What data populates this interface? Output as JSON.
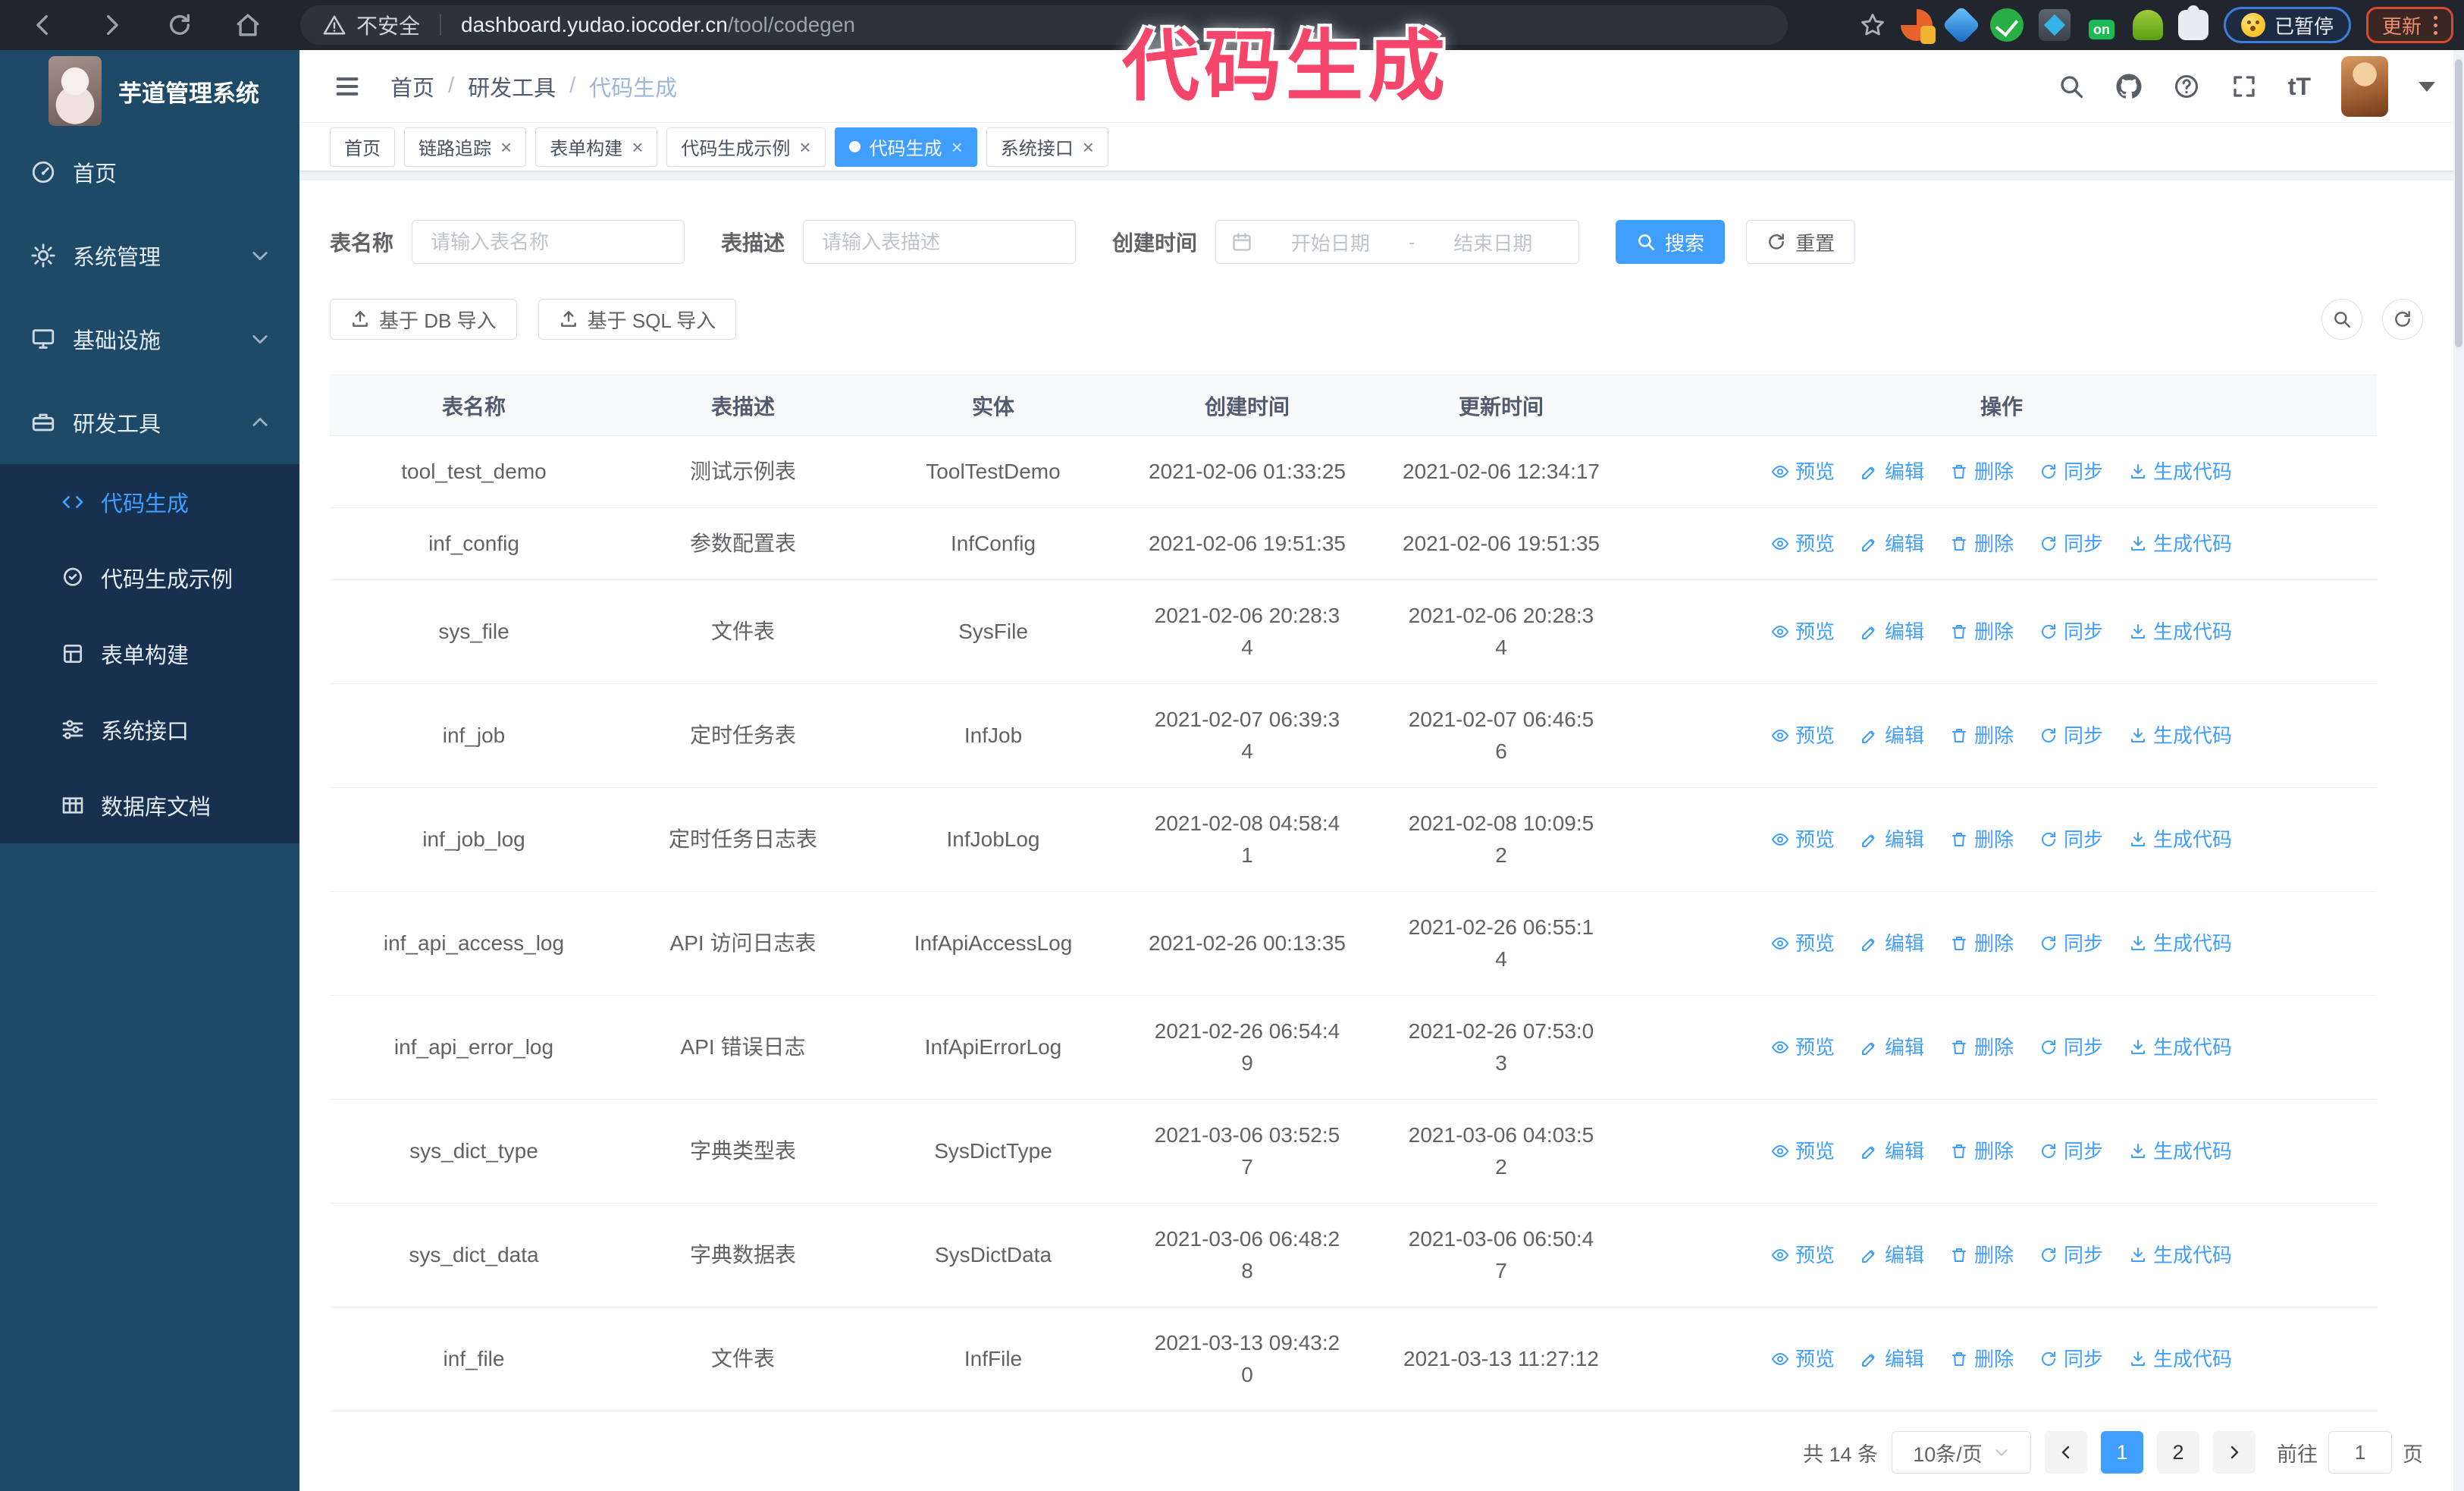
{
  "browser": {
    "security_label": "不安全",
    "url_host": "dashboard.yudao.iocoder.cn",
    "url_path": "/tool/codegen",
    "paused_badge": "已暂停",
    "update_button": "更新"
  },
  "annotation": {
    "text": "代码生成",
    "color": "#f5456b"
  },
  "app": {
    "title": "芋道管理系统"
  },
  "breadcrumb": {
    "separator": "/",
    "items": [
      "首页",
      "研发工具",
      "代码生成"
    ]
  },
  "sidebar": {
    "items": [
      {
        "label": "首页",
        "icon": "dashboard-icon"
      },
      {
        "label": "系统管理",
        "icon": "gear-icon",
        "state": "collapsed"
      },
      {
        "label": "基础设施",
        "icon": "monitor-icon",
        "state": "collapsed"
      },
      {
        "label": "研发工具",
        "icon": "toolbox-icon",
        "state": "expanded",
        "children": [
          {
            "label": "代码生成",
            "icon": "code-icon",
            "active": true
          },
          {
            "label": "代码生成示例",
            "icon": "badge-check-icon",
            "active": false
          },
          {
            "label": "表单构建",
            "icon": "form-icon",
            "active": false
          },
          {
            "label": "系统接口",
            "icon": "sliders-icon",
            "active": false
          },
          {
            "label": "数据库文档",
            "icon": "table-grid-icon",
            "active": false
          }
        ]
      }
    ]
  },
  "tags": {
    "items": [
      {
        "label": "首页",
        "closable": false,
        "active": false
      },
      {
        "label": "链路追踪",
        "closable": true,
        "active": false
      },
      {
        "label": "表单构建",
        "closable": true,
        "active": false
      },
      {
        "label": "代码生成示例",
        "closable": true,
        "active": false
      },
      {
        "label": "代码生成",
        "closable": true,
        "active": true
      },
      {
        "label": "系统接口",
        "closable": true,
        "active": false
      }
    ]
  },
  "search": {
    "name_label": "表名称",
    "name_placeholder": "请输入表名称",
    "desc_label": "表描述",
    "desc_placeholder": "请输入表描述",
    "time_label": "创建时间",
    "start_placeholder": "开始日期",
    "range_separator": "-",
    "end_placeholder": "结束日期",
    "search_label": "搜索",
    "reset_label": "重置"
  },
  "toolbar": {
    "db_import_label": "基于 DB 导入",
    "sql_import_label": "基于 SQL 导入"
  },
  "table": {
    "columns": [
      "表名称",
      "表描述",
      "实体",
      "创建时间",
      "更新时间",
      "操作"
    ],
    "row_actions": [
      {
        "label": "预览",
        "icon": "eye-icon"
      },
      {
        "label": "编辑",
        "icon": "edit-icon"
      },
      {
        "label": "删除",
        "icon": "trash-icon"
      },
      {
        "label": "同步",
        "icon": "sync-icon"
      },
      {
        "label": "生成代码",
        "icon": "download-icon"
      }
    ],
    "rows": [
      {
        "name": "tool_test_demo",
        "desc": "测试示例表",
        "entity": "ToolTestDemo",
        "created": "2021-02-06 01:33:25",
        "updated": "2021-02-06 12:34:17"
      },
      {
        "name": "inf_config",
        "desc": "参数配置表",
        "entity": "InfConfig",
        "created": "2021-02-06 19:51:35",
        "updated": "2021-02-06 19:51:35"
      },
      {
        "name": "sys_file",
        "desc": "文件表",
        "entity": "SysFile",
        "created": "2021-02-06 20:28:3\n4",
        "updated": "2021-02-06 20:28:3\n4"
      },
      {
        "name": "inf_job",
        "desc": "定时任务表",
        "entity": "InfJob",
        "created": "2021-02-07 06:39:3\n4",
        "updated": "2021-02-07 06:46:5\n6"
      },
      {
        "name": "inf_job_log",
        "desc": "定时任务日志表",
        "entity": "InfJobLog",
        "created": "2021-02-08 04:58:4\n1",
        "updated": "2021-02-08 10:09:5\n2"
      },
      {
        "name": "inf_api_access_log",
        "desc": "API 访问日志表",
        "entity": "InfApiAccessLog",
        "created": "2021-02-26 00:13:35",
        "updated": "2021-02-26 06:55:1\n4"
      },
      {
        "name": "inf_api_error_log",
        "desc": "API 错误日志",
        "entity": "InfApiErrorLog",
        "created": "2021-02-26 06:54:4\n9",
        "updated": "2021-02-26 07:53:0\n3"
      },
      {
        "name": "sys_dict_type",
        "desc": "字典类型表",
        "entity": "SysDictType",
        "created": "2021-03-06 03:52:5\n7",
        "updated": "2021-03-06 04:03:5\n2"
      },
      {
        "name": "sys_dict_data",
        "desc": "字典数据表",
        "entity": "SysDictData",
        "created": "2021-03-06 06:48:2\n8",
        "updated": "2021-03-06 06:50:4\n7"
      },
      {
        "name": "inf_file",
        "desc": "文件表",
        "entity": "InfFile",
        "created": "2021-03-13 09:43:2\n0",
        "updated": "2021-03-13 11:27:12"
      }
    ]
  },
  "pagination": {
    "total": "共 14 条",
    "page_size": "10条/页",
    "pages": [
      "1",
      "2"
    ],
    "active_page": "1",
    "goto_label": "前往",
    "goto_value": "1",
    "page_unit": "页"
  },
  "colors": {
    "accent": "#409eff",
    "sidebar_bg": "#1e4a68",
    "submenu_bg": "#16304d",
    "chrome_bg": "#21262e",
    "annotation": "#f5456b"
  },
  "icons": [
    "back-icon",
    "forward-icon",
    "reload-icon",
    "home-icon",
    "warning-icon",
    "star-icon",
    "search-icon",
    "github-icon",
    "help-icon",
    "fullscreen-icon",
    "font-size-icon",
    "caret-down-icon",
    "hamburger-icon",
    "calendar-icon",
    "upload-icon",
    "eye-icon",
    "edit-icon",
    "trash-icon",
    "sync-icon",
    "download-icon",
    "refresh-icon",
    "close-icon",
    "chevron-down-icon",
    "chevron-up-icon"
  ]
}
